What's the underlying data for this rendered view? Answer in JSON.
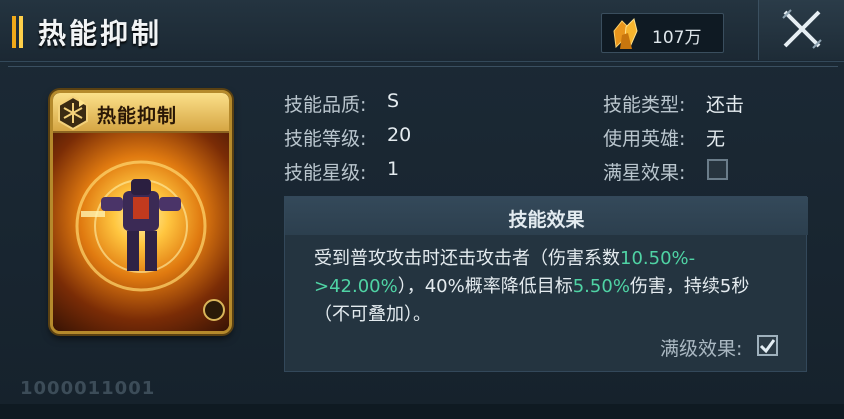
{
  "header": {
    "title": "热能抑制",
    "currency_value": "107万",
    "currency_icon": "crystal-icon",
    "close_icon": "close-icon"
  },
  "card": {
    "title": "热能抑制",
    "badge_icon": "skill-badge-icon",
    "corner_icon": "fist-icon"
  },
  "info": {
    "quality_label": "技能品质:",
    "quality_value": "S",
    "level_label": "技能等级:",
    "level_value": "20",
    "star_label": "技能星级:",
    "star_value": "1",
    "type_label": "技能类型:",
    "type_value": "还击",
    "hero_label": "使用英雄:",
    "hero_value": "无",
    "full_star_label": "满星效果:",
    "full_star_checked": false
  },
  "effect": {
    "title": "技能效果",
    "text_1": "受到普攻攻击时还击攻击者（伤害系数",
    "text_hl_1": "10.50%->42.00%",
    "text_2": "），40%概率降低目标",
    "text_hl_2": "5.50%",
    "text_3": "伤害，持续5秒（不可叠加）。",
    "max_label": "满级效果:",
    "max_checked": true
  },
  "footer": {
    "code": "1000011001"
  },
  "colors": {
    "accent": "#f0a91a",
    "highlight": "#4fd3a4",
    "background": "#16222c"
  }
}
